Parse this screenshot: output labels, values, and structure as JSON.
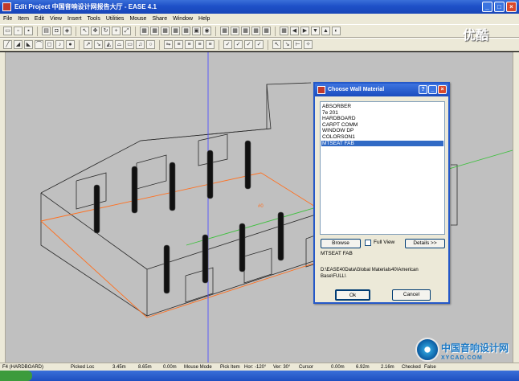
{
  "window": {
    "title": "Edit Project  中国音响设计网报告大厅 - EASE 4.1"
  },
  "menu": [
    "File",
    "Item",
    "Edit",
    "View",
    "Insert",
    "Tools",
    "Utilities",
    "Mouse",
    "Share",
    "Window",
    "Help"
  ],
  "watermark": "优酷",
  "dialog": {
    "title": "Choose Wall Material",
    "materials": [
      "ABSORBER",
      "7e 201",
      "HARDBOARD",
      "CARPT COMM",
      "WINDOW DP",
      "COLORSON1",
      "MTSEAT FAB"
    ],
    "selected_index": 6,
    "browse_label": "Browse",
    "full_view_label": "Full View",
    "full_view_checked": false,
    "details_label": "Details >>",
    "selected_name": "MTSEAT FAB",
    "path": "D:\\EASE40Data\\Global Materials40\\American Base\\FULL\\",
    "ok_label": "Ok",
    "cancel_label": "Cancel"
  },
  "status": {
    "item": "F4 (HARDBOARD)",
    "mode": "Picked Loc",
    "x": "3.45m",
    "y": "8.65m",
    "z": "0.00m",
    "mouse_mode": "Mouse Mode",
    "pick_item": "Pick Item",
    "hor": "Hor: -120°",
    "ver": "Ver: 30°",
    "cursor": "Cursor",
    "cx": "0.00m",
    "cy": "6.92m",
    "cz": "2.16m",
    "checked": "Checked",
    "false": "False"
  },
  "logo": {
    "line1": "中国音响设计网",
    "line2": "XYCAD.COM"
  },
  "colors": {
    "titlebar": "#1e50c8",
    "selection": "#316ac5",
    "axis_blue": "#5050ff",
    "axis_orange": "#ff7020",
    "axis_green": "#40c040",
    "viewport": "#c0c0c0"
  }
}
